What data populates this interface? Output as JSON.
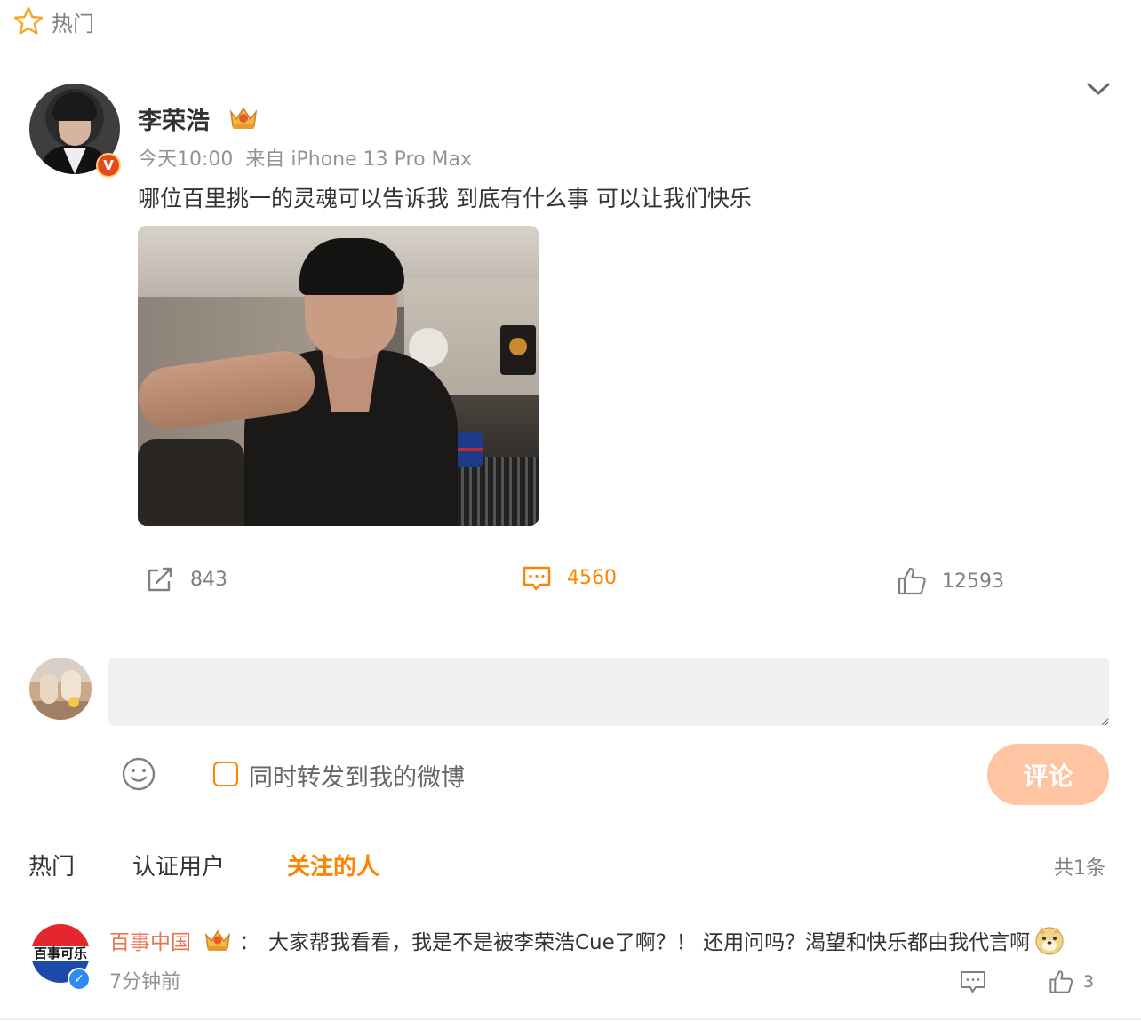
{
  "section": {
    "label": "热门",
    "icon": "star-icon"
  },
  "post": {
    "author": "李荣浩",
    "author_badge": "crown-badge-icon",
    "verified": "V",
    "time": "今天10:00",
    "source": "来自 iPhone 13 Pro Max",
    "text": "哪位百里挑一的灵魂可以告诉我 到底有什么事 可以让我们快乐",
    "image": "selfie-photo",
    "stats": {
      "reposts": "843",
      "comments": "4560",
      "likes": "12593"
    }
  },
  "composer": {
    "placeholder": "",
    "repost_label": "同时转发到我的微博",
    "submit_label": "评论",
    "submit_color": "#ffc4a1"
  },
  "comment_tabs": {
    "tabs": [
      "热门",
      "认证用户",
      "关注的人"
    ],
    "active": "关注的人",
    "total": "共1条"
  },
  "comments": [
    {
      "user": "百事中国",
      "avatar_text": "百事可乐",
      "text": "大家帮我看看，我是不是被李荣浩Cue了啊？！ 还用问吗？渴望和快乐都由我代言啊",
      "time": "7分钟前",
      "likes": "3",
      "verified": "✓"
    }
  ],
  "colors": {
    "accent": "#ff8200",
    "username_link": "#eb7350",
    "muted": "#939393"
  }
}
